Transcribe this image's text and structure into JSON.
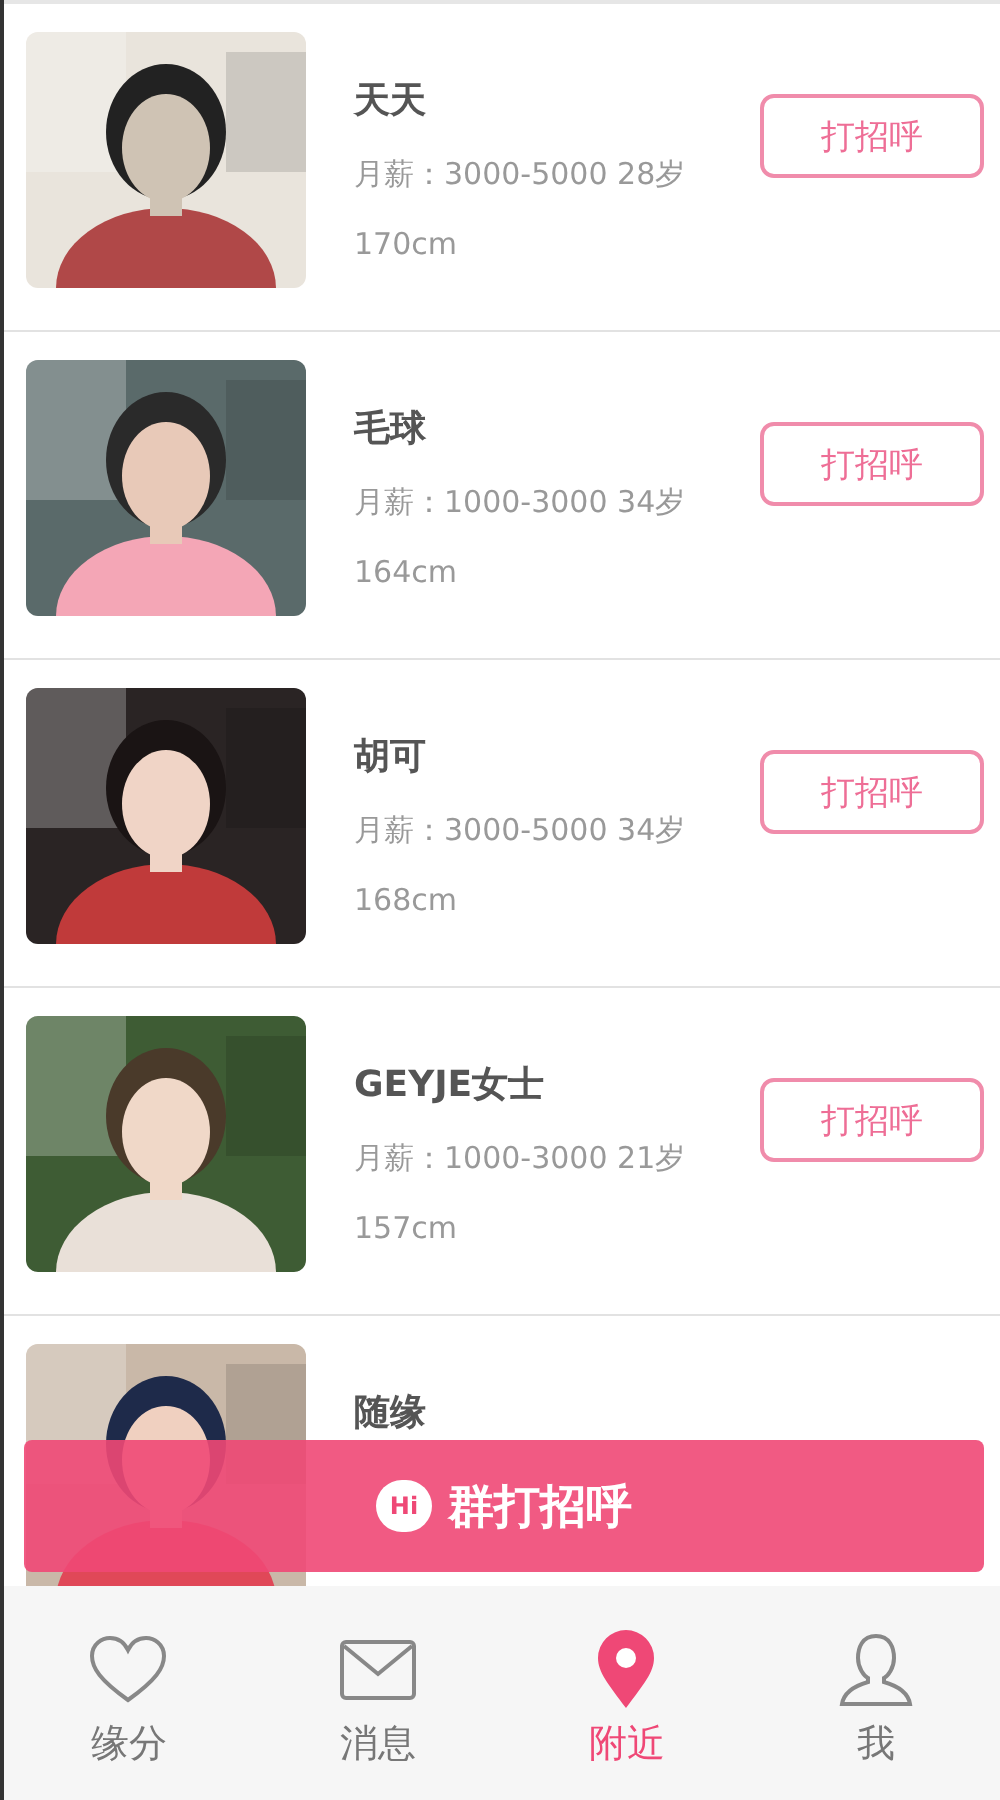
{
  "people": [
    {
      "name": "天天",
      "salary": "月薪：3000-5000 28岁",
      "height": "170cm",
      "button": "打招呼"
    },
    {
      "name": "毛球",
      "salary": "月薪：1000-3000 34岁",
      "height": "164cm",
      "button": "打招呼"
    },
    {
      "name": "胡可",
      "salary": "月薪：3000-5000 34岁",
      "height": "168cm",
      "button": "打招呼"
    },
    {
      "name": "GEYJE女士",
      "salary": "月薪：1000-3000 21岁",
      "height": "157cm",
      "button": "打招呼"
    },
    {
      "name": "随缘"
    }
  ],
  "banner": {
    "badge": "Hi",
    "label": "群打招呼"
  },
  "tabs": [
    {
      "label": "缘分",
      "kind": "heart",
      "selected": false
    },
    {
      "label": "消息",
      "kind": "mail",
      "selected": false
    },
    {
      "label": "附近",
      "kind": "pin",
      "selected": true
    },
    {
      "label": "我",
      "kind": "user",
      "selected": false
    }
  ]
}
